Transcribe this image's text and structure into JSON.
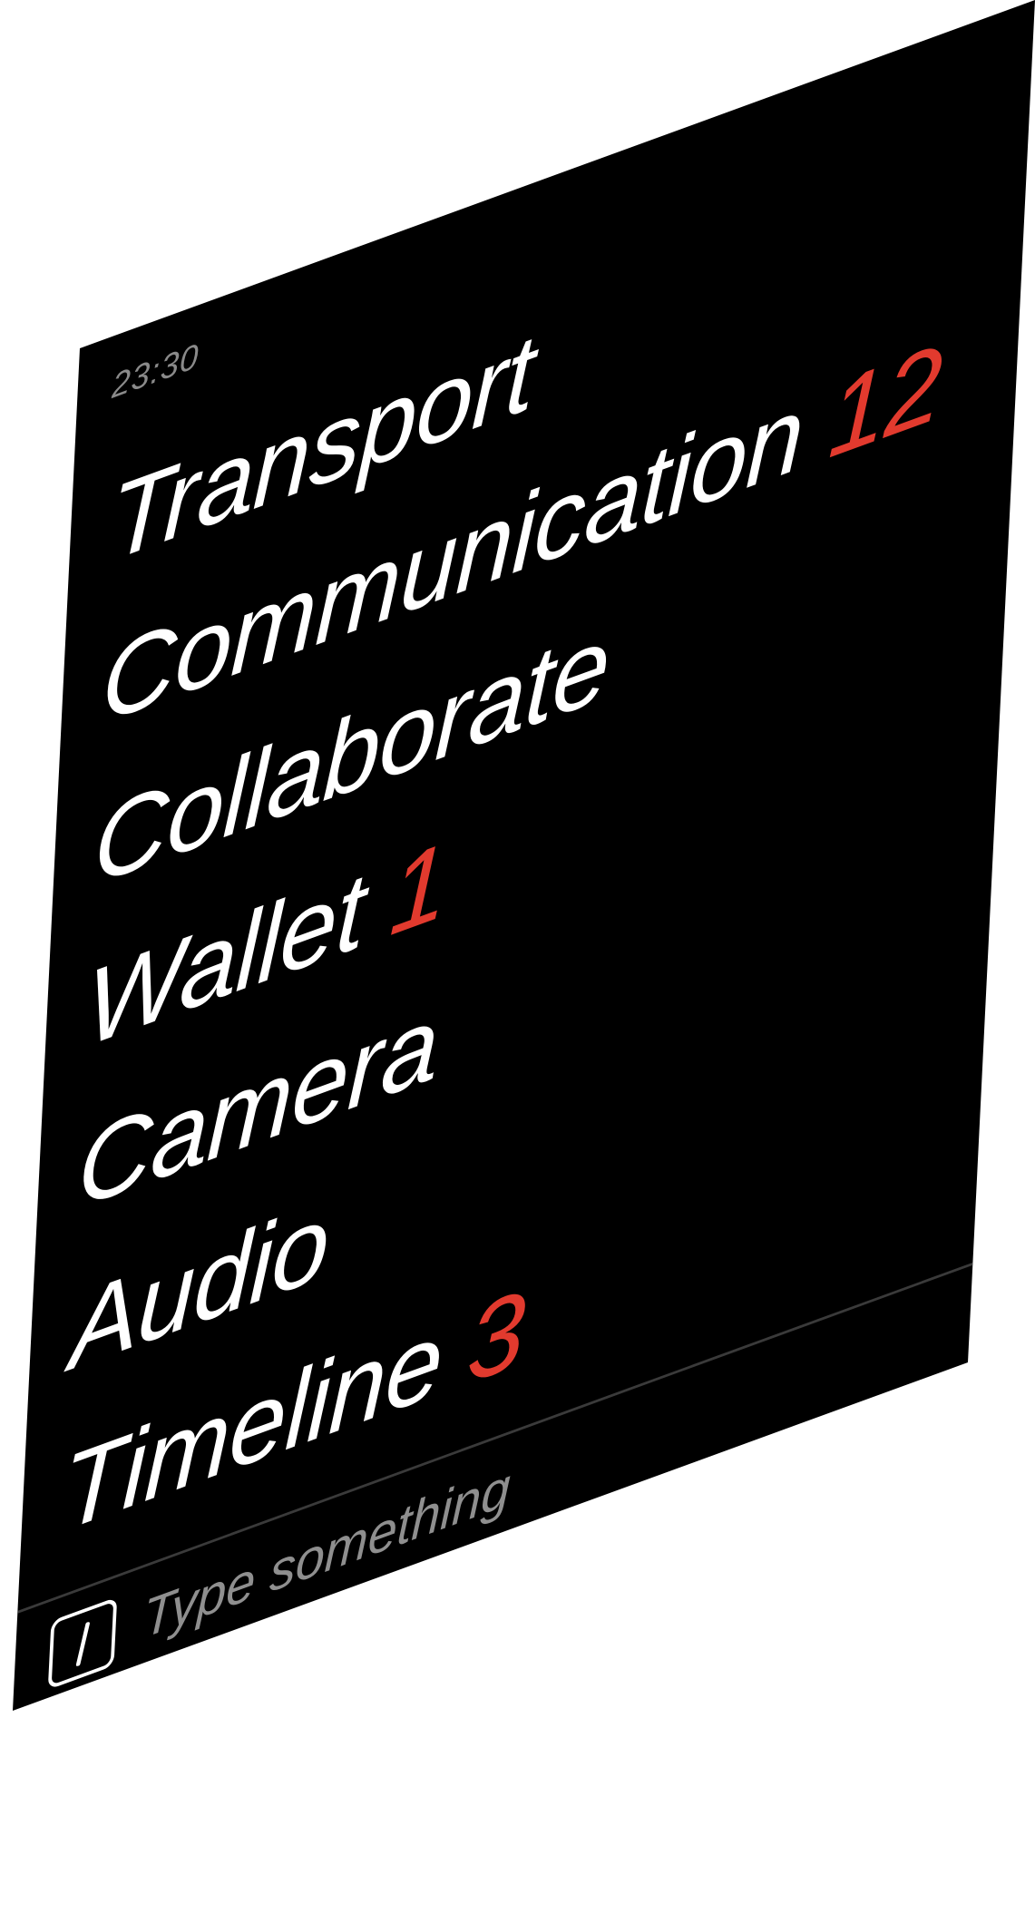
{
  "status": {
    "time": "23:30"
  },
  "menu": {
    "items": [
      {
        "label": "Transport",
        "badge": ""
      },
      {
        "label": "Communication",
        "badge": "12"
      },
      {
        "label": "Collaborate",
        "badge": ""
      },
      {
        "label": "Wallet",
        "badge": "1"
      },
      {
        "label": "Camera",
        "badge": ""
      },
      {
        "label": "Audio",
        "badge": ""
      },
      {
        "label": "Timeline",
        "badge": "3"
      }
    ]
  },
  "input": {
    "value": "",
    "placeholder": "Type something",
    "icon": "slash-command-icon"
  },
  "colors": {
    "background": "#000000",
    "text": "#ffffff",
    "badge": "#e23a2e",
    "muted": "#8a8a8a"
  }
}
